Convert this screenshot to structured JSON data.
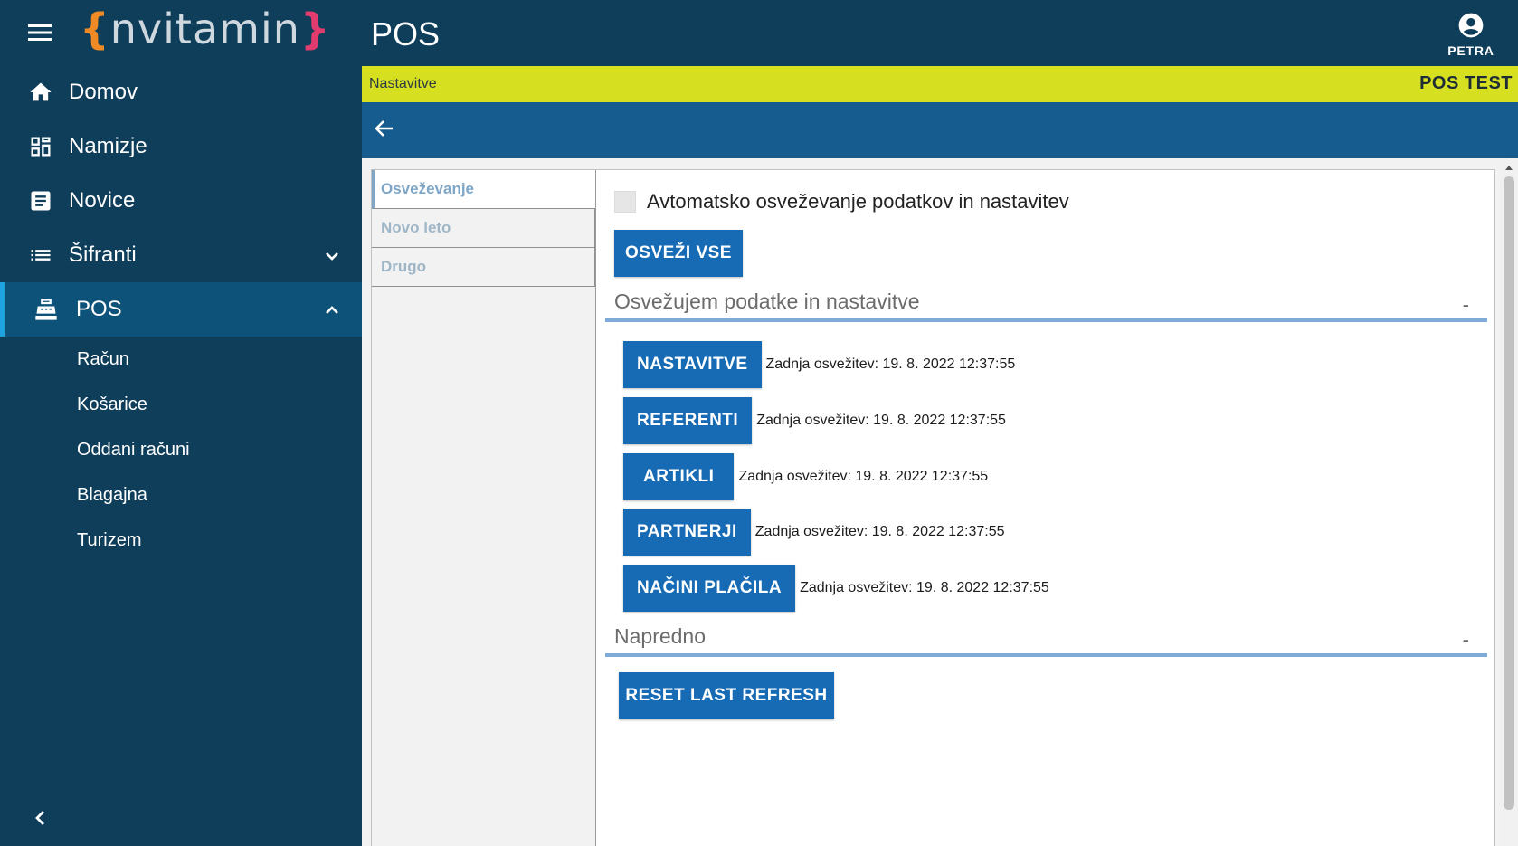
{
  "sidebar": {
    "logo": {
      "left": "{",
      "word": "nvitamin",
      "right": "}"
    },
    "nav": [
      {
        "label": "Domov",
        "icon": "home-icon"
      },
      {
        "label": "Namizje",
        "icon": "dashboard-icon"
      },
      {
        "label": "Novice",
        "icon": "article-icon"
      },
      {
        "label": "Šifranti",
        "icon": "list-icon",
        "expandable": true,
        "expanded": false
      },
      {
        "label": "POS",
        "icon": "cash-register-icon",
        "expandable": true,
        "expanded": true,
        "active": true
      }
    ],
    "pos_subitems": [
      "Račun",
      "Košarice",
      "Oddani računi",
      "Blagajna",
      "Turizem"
    ]
  },
  "topbar": {
    "title": "POS",
    "user": "PETRA"
  },
  "breadcrumb": {
    "page": "Nastavitve",
    "environment": "POS TEST"
  },
  "tabs": [
    "Osveževanje",
    "Novo leto",
    "Drugo"
  ],
  "refresh": {
    "auto_refresh_label": "Avtomatsko osveževanje podatkov in nastavitev",
    "auto_refresh_checked": false,
    "refresh_all_label": "OSVEŽI VSE",
    "section_title": "Osvežujem podatke in nastavitve",
    "section_toggle": "-",
    "rows": [
      {
        "label": "NASTAVITVE",
        "timestamp": "Zadnja osvežitev: 19. 8. 2022 12:37:55"
      },
      {
        "label": "REFERENTI",
        "timestamp": "Zadnja osvežitev: 19. 8. 2022 12:37:55"
      },
      {
        "label": "ARTIKLI",
        "timestamp": "Zadnja osvežitev: 19. 8. 2022 12:37:55"
      },
      {
        "label": "PARTNERJI",
        "timestamp": "Zadnja osvežitev: 19. 8. 2022 12:37:55"
      },
      {
        "label": "NAČINI PLAČILA",
        "timestamp": "Zadnja osvežitev: 19. 8. 2022 12:37:55"
      }
    ]
  },
  "advanced": {
    "section_title": "Napredno",
    "section_toggle": "-",
    "reset_label": "RESET LAST REFRESH"
  },
  "colors": {
    "sidebar_bg": "#0f3e5a",
    "active_nav_bg": "#0d5278",
    "active_nav_accent": "#1ea2e0",
    "breadcrumb_bar": "#d6e021",
    "toolbar_bar": "#175c8e",
    "button_blue": "#176bb5",
    "section_rule": "#7eaad8"
  }
}
